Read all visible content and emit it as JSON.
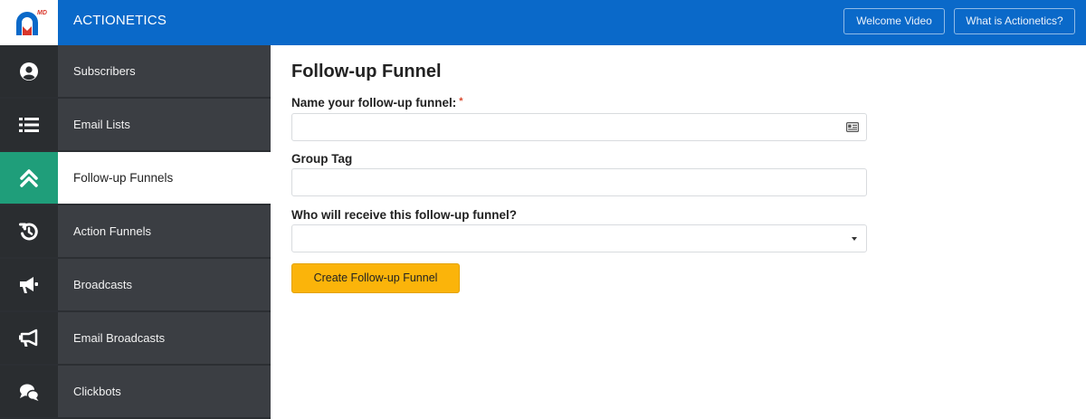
{
  "header": {
    "brand": "ACTIONETICS",
    "logo_badge": "MD",
    "buttons": {
      "welcome_video": "Welcome Video",
      "what_is": "What is Actionetics?"
    }
  },
  "sidebar": {
    "items": [
      {
        "label": "Subscribers",
        "icon": "user-circle-icon",
        "active": false
      },
      {
        "label": "Email Lists",
        "icon": "list-icon",
        "active": false
      },
      {
        "label": "Follow-up Funnels",
        "icon": "double-chevron-up-icon",
        "active": true
      },
      {
        "label": "Action Funnels",
        "icon": "history-icon",
        "active": false
      },
      {
        "label": "Broadcasts",
        "icon": "megaphone-icon",
        "active": false
      },
      {
        "label": "Email Broadcasts",
        "icon": "bullhorn-icon",
        "active": false
      },
      {
        "label": "Clickbots",
        "icon": "chat-bubbles-icon",
        "active": false
      }
    ]
  },
  "form": {
    "title": "Follow-up Funnel",
    "name_label": "Name your follow-up funnel:",
    "required_mark": "*",
    "name_value": "",
    "group_tag_label": "Group Tag",
    "group_tag_value": "",
    "recipients_label": "Who will receive this follow-up funnel?",
    "recipients_value": "",
    "submit_label": "Create Follow-up Funnel"
  },
  "colors": {
    "header_blue": "#0a69c9",
    "sidebar_dark": "#2c2f33",
    "active_green": "#1f9e7a",
    "button_yellow": "#fbb40a",
    "required_red": "#d9472b"
  }
}
